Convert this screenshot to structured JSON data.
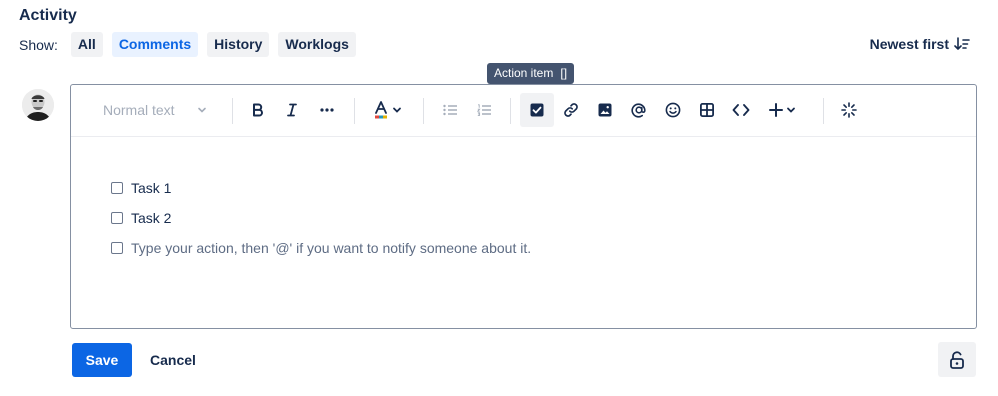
{
  "activity": {
    "heading": "Activity",
    "show_label": "Show:",
    "filters": [
      "All",
      "Comments",
      "History",
      "Worklogs"
    ],
    "active_filter": "Comments",
    "sort_label": "Newest first"
  },
  "tooltip": {
    "label": "Action item",
    "shortcut": "[]"
  },
  "editor": {
    "text_style": "Normal text",
    "toolbar_icons": [
      "bold-icon",
      "italic-icon",
      "more-icon",
      "text-color-icon",
      "bullet-list-icon",
      "numbered-list-icon",
      "action-item-icon",
      "link-icon",
      "image-icon",
      "mention-icon",
      "emoji-icon",
      "table-icon",
      "code-icon",
      "insert-icon",
      "ai-icon"
    ],
    "tasks": [
      "Task 1",
      "Task 2"
    ],
    "task_placeholder": "Type your action, then '@' if you want to notify someone about it."
  },
  "actions": {
    "save_label": "Save",
    "cancel_label": "Cancel"
  },
  "colors": {
    "primary": "#0c66e4",
    "text": "#172b4d",
    "chip_bg": "#f1f2f4",
    "chip_active_bg": "#e9f2ff",
    "tooltip_bg": "#44546f"
  }
}
